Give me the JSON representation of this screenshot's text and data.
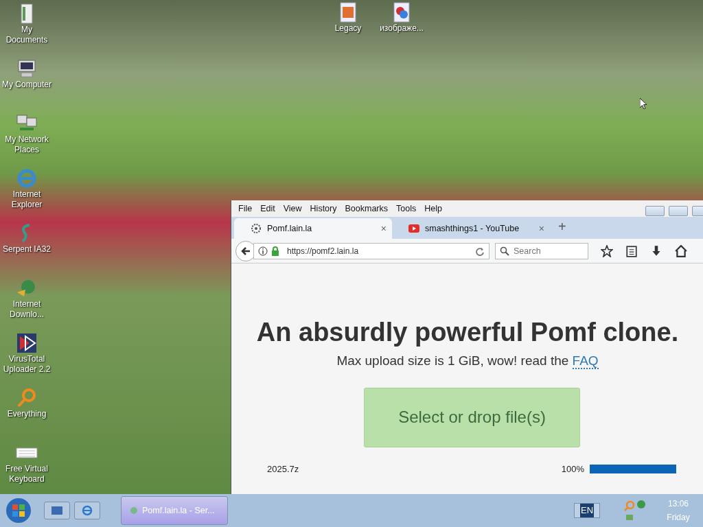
{
  "desktop_icons": [
    {
      "label": "My Documents",
      "kind": "document"
    },
    {
      "label": "My Computer",
      "kind": "computer"
    },
    {
      "label": "My Network Places",
      "kind": "network"
    },
    {
      "label": "Internet Explorer",
      "kind": "ie"
    },
    {
      "label": "Serpent IA32",
      "kind": "serpent"
    },
    {
      "label": "Internet Downlo...",
      "kind": "globe"
    },
    {
      "label": "VirusTotal Uploader 2.2",
      "kind": "arrow"
    },
    {
      "label": "Everything",
      "kind": "search"
    },
    {
      "label": "Free Virtual Keyboard",
      "kind": "keyboard"
    }
  ],
  "top_icons": [
    {
      "label": "Legacy",
      "kind": "legacy"
    },
    {
      "label": "изображе...",
      "kind": "image"
    }
  ],
  "browser": {
    "menu": [
      "File",
      "Edit",
      "View",
      "History",
      "Bookmarks",
      "Tools",
      "Help"
    ],
    "tabs": [
      {
        "label": "Pomf.lain.la",
        "selected": true,
        "kind": "gear",
        "close": "×"
      },
      {
        "label": "smashthings1 - YouTube",
        "selected": false,
        "kind": "youtube",
        "close": "×"
      }
    ],
    "new_tab": "+",
    "url": "https://pomf2.lain.la",
    "search_placeholder": "Search",
    "page": {
      "heading": "An absurdly powerful Pomf clone.",
      "subtitle": "Max upload size is 1 GiB, wow! read the ",
      "faq_link": "FAQ",
      "upload_button": "Select or drop file(s)",
      "file": {
        "name": "2025.7z",
        "percent": "100%",
        "level": 1
      }
    }
  },
  "taskbar": {
    "task": "Pomf.lain.la - Ser...",
    "language": "EN",
    "time": "13:06",
    "day": "Friday"
  }
}
